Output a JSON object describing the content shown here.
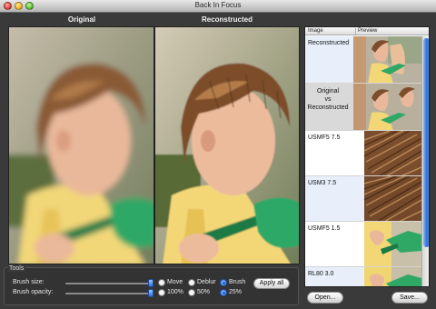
{
  "window": {
    "title": "Back In Focus"
  },
  "panels": {
    "original_title": "Original",
    "reconstructed_title": "Reconstructed"
  },
  "tools": {
    "group_label": "Tools",
    "brush_size_label": "Brush size:",
    "brush_opacity_label": "Brush opacity:",
    "brush_size_value": 1.0,
    "brush_opacity_value": 1.0,
    "mode_options": [
      {
        "label": "Move",
        "selected": false
      },
      {
        "label": "Deblur",
        "selected": false
      },
      {
        "label": "Brush",
        "selected": true
      }
    ],
    "opacity_options": [
      {
        "label": "100%",
        "selected": false
      },
      {
        "label": "50%",
        "selected": false
      },
      {
        "label": "25%",
        "selected": true
      }
    ],
    "apply_all_label": "Apply all"
  },
  "list": {
    "columns": {
      "image": "Image",
      "preview": "Preview"
    },
    "rows": [
      {
        "name": "Reconstructed",
        "thumb": "wide"
      },
      {
        "name": "Original\nvs\nReconstructed",
        "thumb": "wide"
      },
      {
        "name": "USMF5 7.5",
        "thumb": "hair"
      },
      {
        "name": "USM3 7.5",
        "thumb": "hair"
      },
      {
        "name": "USMF5 1.5",
        "thumb": "shovel"
      },
      {
        "name": "RL80 3.0",
        "thumb": "shovel"
      }
    ]
  },
  "buttons": {
    "open": "Open...",
    "save": "Save..."
  },
  "colors": {
    "accent_blue": "#2e72dc",
    "shovel_green": "#2fa866",
    "shirt_yellow": "#f3d777"
  }
}
